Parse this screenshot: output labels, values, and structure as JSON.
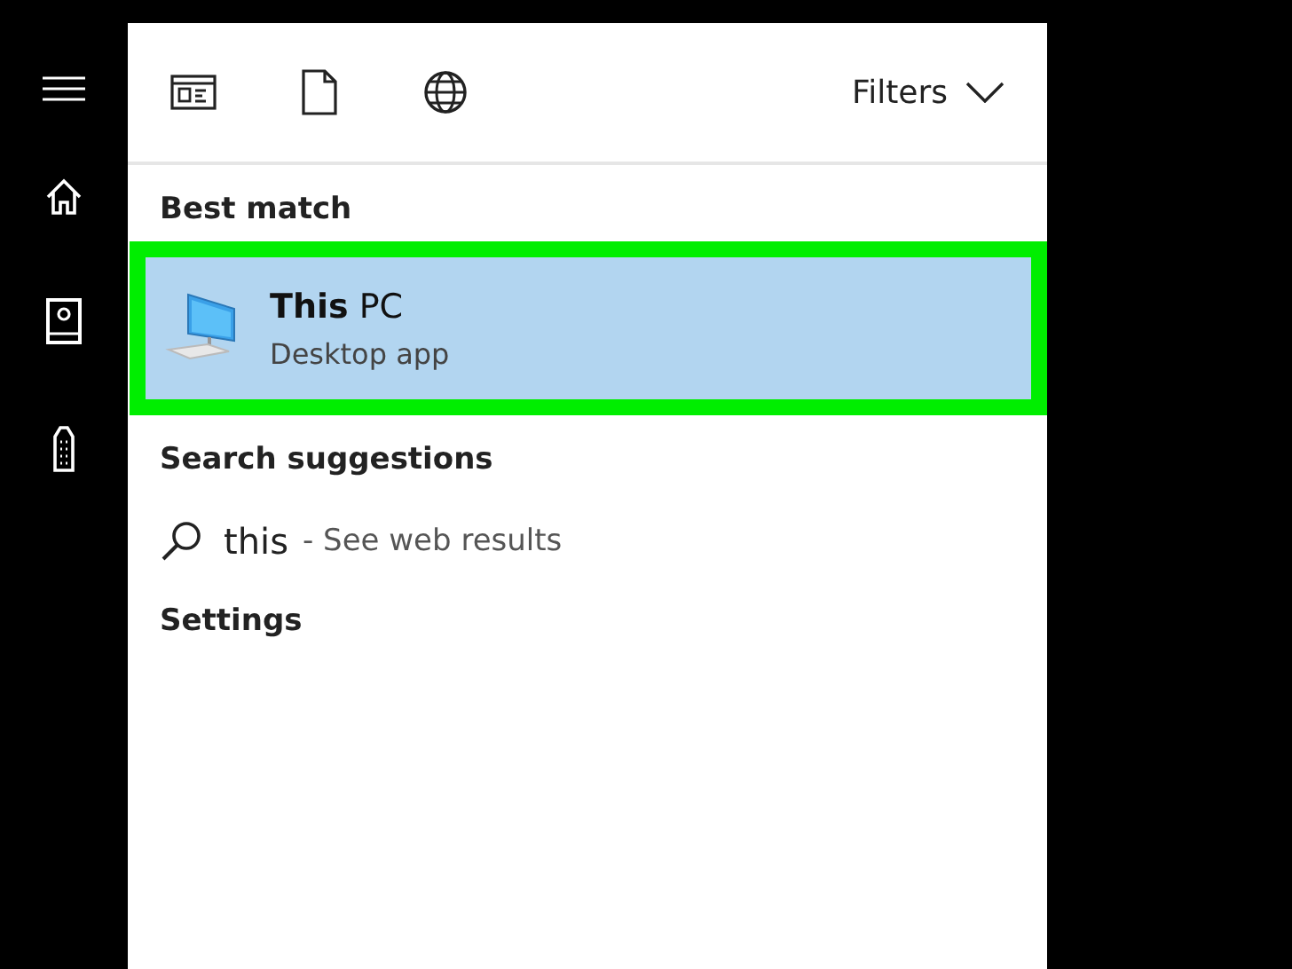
{
  "sidebar": {
    "items": [
      {
        "kind": "menu"
      },
      {
        "kind": "home"
      },
      {
        "kind": "notebook"
      },
      {
        "kind": "device"
      }
    ]
  },
  "toolbar": {
    "filters_label": "Filters"
  },
  "best_match": {
    "heading": "Best match",
    "result": {
      "title": "**This** PC",
      "subtitle": "Desktop app",
      "selected": true,
      "highlighted": true
    }
  },
  "search_suggestions": {
    "heading": "Search suggestions",
    "items": [
      {
        "query": "this",
        "hint": "- See web results"
      }
    ]
  },
  "settings": {
    "heading": "Settings"
  }
}
